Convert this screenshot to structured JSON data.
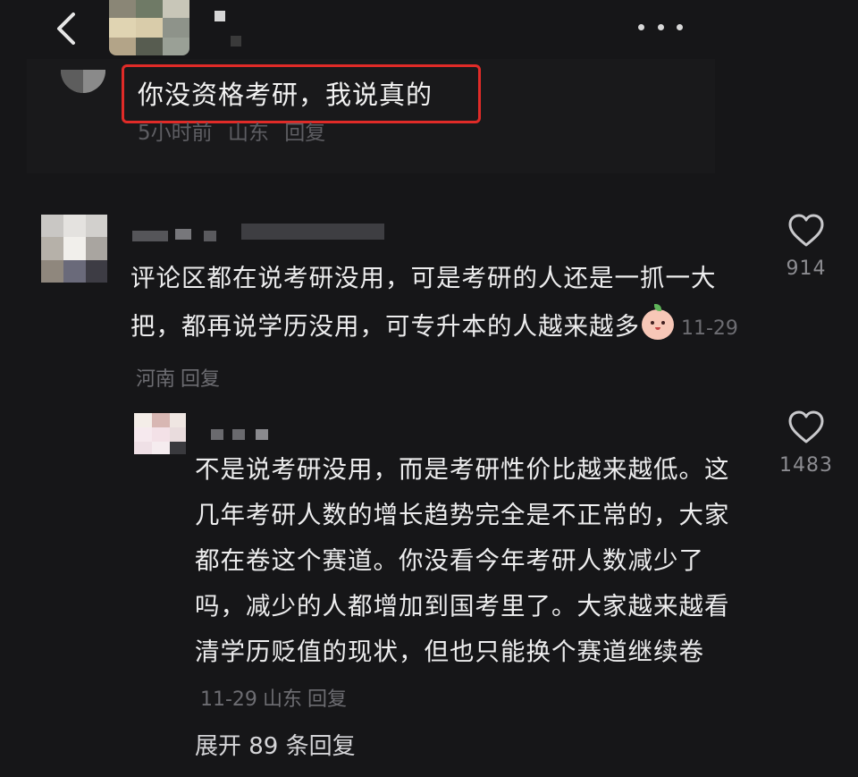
{
  "header": {
    "back_icon": "chevron-left-icon",
    "more_icon": "more-dots-icon"
  },
  "top_comment": {
    "text": "你没资格考研，我说真的",
    "time": "5小时前",
    "location": "山东",
    "reply_label": "回复",
    "highlight_color": "#e02b28"
  },
  "comments": [
    {
      "text_main": "评论区都在说考研没用，可是考研的人还是一抓一大把，都再说学历没用，可专升本的人越来越多",
      "emoji": "baby-face-emoji",
      "date": "11-29",
      "location": "河南",
      "reply_label": "回复",
      "like_count": "914"
    },
    {
      "text_main": "不是说考研没用，而是考研性价比越来越低。这几年考研人数的增长趋势完全是不正常的，大家都在卷这个赛道。你没看今年考研人数减少了吗，减少的人都增加到国考里了。大家越来越看清学历贬值的现状，但也只能换个赛道继续卷",
      "date": "11-29",
      "location": "山东",
      "reply_label": "回复",
      "like_count": "1483"
    }
  ],
  "expand_replies": "展开 89 条回复"
}
